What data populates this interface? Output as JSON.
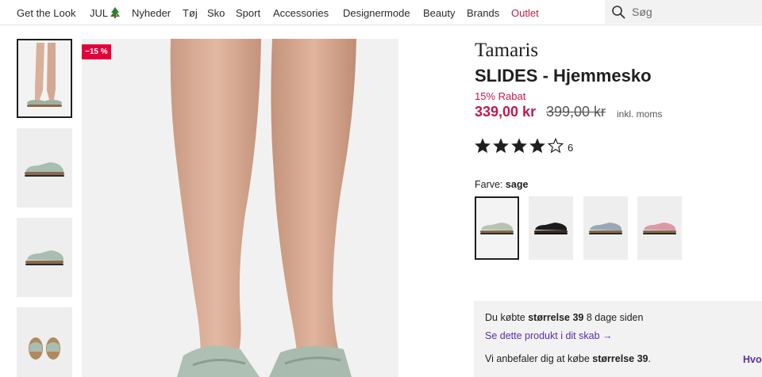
{
  "nav": {
    "items": [
      {
        "label": "Get the Look"
      },
      {
        "label": "JUL"
      },
      {
        "label": "Nyheder"
      },
      {
        "label": "Tøj"
      },
      {
        "label": "Sko"
      },
      {
        "label": "Sport"
      },
      {
        "label": "Accessories"
      },
      {
        "label": "Designermode"
      },
      {
        "label": "Beauty"
      },
      {
        "label": "Brands"
      },
      {
        "label": "Outlet"
      }
    ],
    "search_placeholder": "Søg"
  },
  "gallery": {
    "badge": "−15 %",
    "thumbnail_count": 4
  },
  "product": {
    "brand": "Tamaris",
    "title": "SLIDES - Hjemmesko",
    "discount_text": "15% Rabat",
    "price": "339,00 kr",
    "old_price": "399,00 kr",
    "tax_note": "inkl. moms",
    "rating": 4,
    "rating_max": 5,
    "rating_count": "6",
    "color_label": "Farve:",
    "color_value": "sage",
    "swatches": [
      {
        "color": "sage",
        "hex": "#b7c4b4"
      },
      {
        "color": "black",
        "hex": "#1c1c1c"
      },
      {
        "color": "grey-blue",
        "hex": "#9aa7b4"
      },
      {
        "color": "pink",
        "hex": "#d99aa6"
      }
    ]
  },
  "size_info": {
    "line1_prefix": "Du købte",
    "line1_bold": "størrelse 39",
    "line1_suffix": "8 dage siden",
    "link": "Se dette produkt i dit skab →",
    "line2_prefix": "Vi anbefaler dig at købe",
    "line2_bold": "størrelse 39",
    "line2_suffix": ".",
    "more_link": "Hvor"
  },
  "colors": {
    "accent": "#c3194a",
    "link": "#5a2ea6",
    "badge": "#e4003a"
  }
}
